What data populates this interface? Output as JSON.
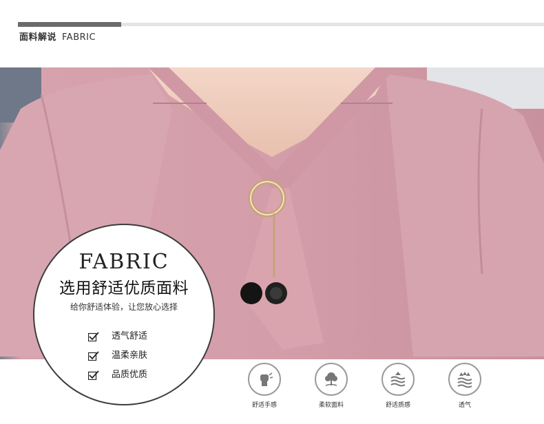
{
  "section_header": {
    "title_cn": "面料解说",
    "title_en": "FABRIC"
  },
  "badge": {
    "heading": "FABRIC",
    "title": "选用舒适优质面料",
    "subtitle": "给你舒适体验，让您放心选择",
    "features": [
      "透气舒适",
      "温柔亲肤",
      "品质优质"
    ]
  },
  "feature_icons": [
    {
      "label": "舒适手感",
      "icon": "hand-fist-icon"
    },
    {
      "label": "柔软面料",
      "icon": "soft-tree-icon"
    },
    {
      "label": "舒适质感",
      "icon": "waves-arrow-icon"
    },
    {
      "label": "透气",
      "icon": "breathable-arrows-icon"
    }
  ],
  "colors": {
    "fabric_pink": "#cf9aa5",
    "accent_bar": "#6b6b6b",
    "circle_border": "#3c3c3c"
  }
}
